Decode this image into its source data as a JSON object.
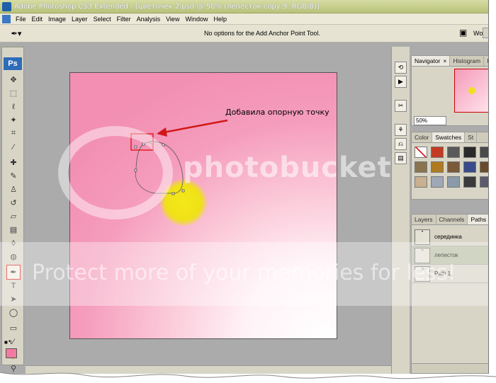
{
  "window": {
    "title": "Adobe Photoshop CS3 Extended - [цветочек 2.psd @ 50% (лепесток copy 9, RGB/8)]"
  },
  "menu": [
    "File",
    "Edit",
    "Image",
    "Layer",
    "Select",
    "Filter",
    "Analysis",
    "View",
    "Window",
    "Help"
  ],
  "options": {
    "message": "No options for the Add Anchor Point Tool.",
    "workspace_label": "Wo"
  },
  "toolbox": {
    "logo": "Ps"
  },
  "annotation": {
    "text": "Добавила опорную точку"
  },
  "navigator": {
    "tabs": [
      "Navigator",
      "Histogram",
      "In"
    ],
    "zoom": "50%"
  },
  "swatches": {
    "tabs": [
      "Color",
      "Swatches",
      "St"
    ],
    "colors": [
      "#ffffff",
      "#c23b22",
      "#5a5a5a",
      "#2a2a2a",
      "#4a4a4a",
      "#8a7450",
      "#b07a20",
      "#7a5a3a",
      "#3a4a8a",
      "#6a4a2a",
      "#c8b090",
      "#a0a8b8",
      "#8a9aa8",
      "#3a3a3a",
      "#5a5a6a"
    ]
  },
  "layers": {
    "tabs": [
      "Layers",
      "Channels",
      "Paths"
    ],
    "paths": [
      {
        "name": "серединка",
        "selected": false
      },
      {
        "name": "лепесток",
        "selected": true
      },
      {
        "name": "Path 1",
        "selected": false
      }
    ]
  },
  "watermark": {
    "brand": "photobucket",
    "protect": "Protect more of your memories for less!"
  }
}
